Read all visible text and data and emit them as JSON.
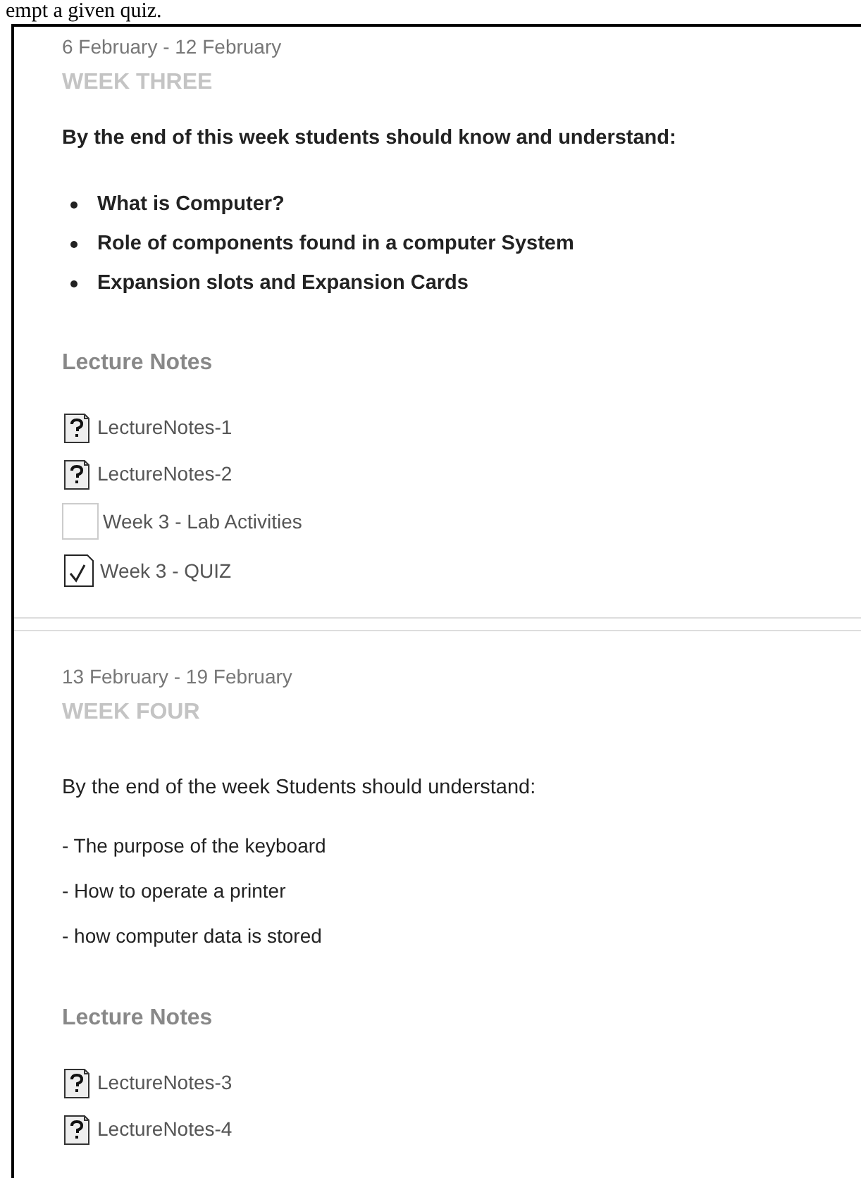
{
  "caption": "empt a given quiz.",
  "weeks": [
    {
      "dates": "6 February - 12 February",
      "title": "WEEK THREE",
      "intro": "By the end of this week students should know and understand:",
      "intro_bold": true,
      "points": [
        {
          "kind": "bullet",
          "text": "What is Computer?"
        },
        {
          "kind": "bullet",
          "text": "Role of components found in a computer System"
        },
        {
          "kind": "bullet",
          "text": "Expansion slots and Expansion Cards"
        }
      ],
      "notes_heading": "Lecture Notes",
      "resources": [
        {
          "kind": "file",
          "label": "LectureNotes-1"
        },
        {
          "kind": "file",
          "label": "LectureNotes-2"
        },
        {
          "kind": "blank",
          "label": "Week 3 - Lab Activities"
        },
        {
          "kind": "quiz",
          "label": "Week 3 - QUIZ"
        }
      ]
    },
    {
      "dates": "13 February - 19 February",
      "title": "WEEK FOUR",
      "intro": "By the end of the week Students should understand:",
      "intro_bold": false,
      "points": [
        {
          "kind": "plain",
          "text": "- The purpose of the keyboard"
        },
        {
          "kind": "plain",
          "text": "- How to operate a printer"
        },
        {
          "kind": "plain",
          "text": "- how computer data is stored"
        }
      ],
      "notes_heading": "Lecture Notes",
      "resources": [
        {
          "kind": "file",
          "label": "LectureNotes-3"
        },
        {
          "kind": "file",
          "label": "LectureNotes-4"
        }
      ]
    }
  ]
}
